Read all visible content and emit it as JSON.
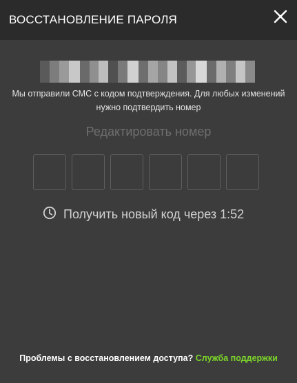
{
  "header": {
    "title": "ВОССТАНОВЛЕНИЕ ПАРОЛЯ"
  },
  "info": {
    "line1": "Мы отправили СМС с кодом подтверждения. Для любых изменений",
    "line2": "нужно подтвердить номер"
  },
  "edit_number_label": "Редактировать номер",
  "code_inputs": [
    "",
    "",
    "",
    "",
    "",
    ""
  ],
  "timer": {
    "text": "Получить новый код через 1:52"
  },
  "footer": {
    "question": "Проблемы с восстановлением доступа?",
    "support_link": "Служба поддержки"
  },
  "colors": {
    "accent": "#7cd62a",
    "background": "#3c3c3c",
    "header": "#2b2b2b"
  }
}
